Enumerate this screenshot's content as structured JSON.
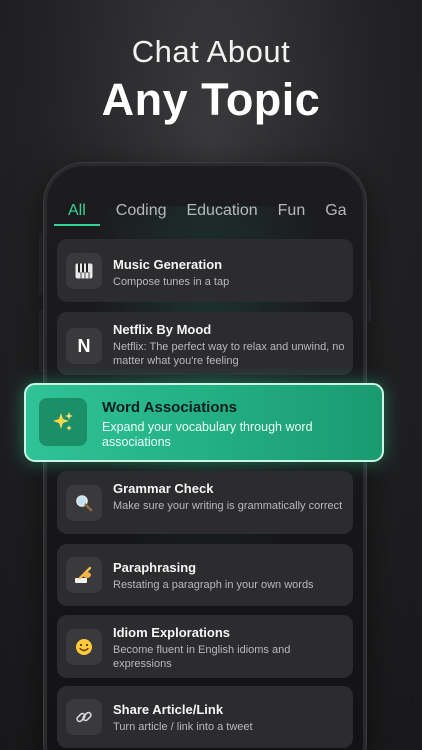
{
  "headline": {
    "line1": "Chat About",
    "line2": "Any Topic"
  },
  "tabs": [
    {
      "label": "All",
      "active": true
    },
    {
      "label": "Coding",
      "active": false
    },
    {
      "label": "Education",
      "active": false
    },
    {
      "label": "Fun",
      "active": false
    },
    {
      "label": "Ga",
      "active": false
    }
  ],
  "cards": [
    {
      "title": "Music Generation",
      "description": "Compose tunes in a tap",
      "icon": "piano-icon"
    },
    {
      "title": "Netflix By Mood",
      "description": "Netflix: The perfect way to relax and unwind, no matter what you're feeling",
      "icon": "netflix-icon",
      "icon_text": "N"
    },
    {
      "title": "Grammar Check",
      "description": "Make sure your writing is grammatically correct",
      "icon": "magnifier-icon"
    },
    {
      "title": "Paraphrasing",
      "description": "Restating a paragraph in your own words",
      "icon": "writing-hand-icon"
    },
    {
      "title": "Idiom Explorations",
      "description": "Become fluent in English idioms and expressions",
      "icon": "smiley-icon"
    },
    {
      "title": "Share Article/Link",
      "description": "Turn article / link into a tweet",
      "icon": "link-icon"
    }
  ],
  "featured": {
    "title": "Word Associations",
    "description": "Expand your vocabulary through word associations",
    "icon": "sparkles-icon"
  },
  "colors": {
    "accent": "#34d399",
    "featured_bg": "#23b083",
    "card_bg": "#2c2c2e"
  }
}
